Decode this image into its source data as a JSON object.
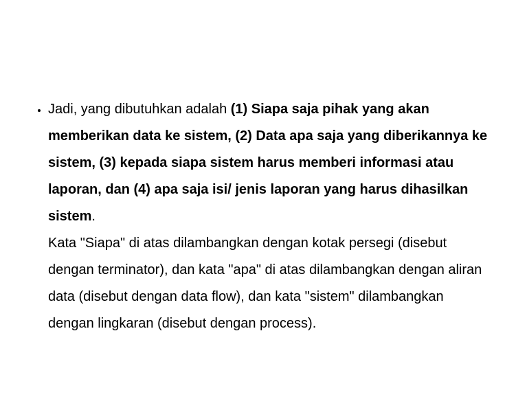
{
  "bullet": {
    "intro": "Jadi, yang dibutuhkan adalah ",
    "p1": "(1) Siapa saja pihak yang akan memberikan data ke sistem, (2) Data apa saja yang diberikannya ke sistem, (3) kepada siapa sistem harus memberi informasi atau laporan, dan (4) apa saja isi/ jenis laporan yang harus dihasilkan sistem",
    "period": ".",
    "p2": "Kata \"Siapa\" di atas dilambangkan dengan kotak persegi (disebut dengan terminator), dan kata \"apa\" di atas dilambangkan dengan aliran data (disebut dengan data flow), dan kata \"sistem\" dilambangkan dengan lingkaran (disebut dengan process)."
  }
}
